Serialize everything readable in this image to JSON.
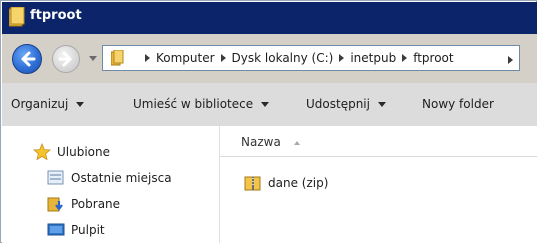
{
  "window": {
    "title": "ftproot"
  },
  "address": {
    "crumbs": [
      "Komputer",
      "Dysk lokalny (C:)",
      "inetpub",
      "ftproot"
    ]
  },
  "toolbar": {
    "organize": "Organizuj",
    "library": "Umieść w bibliotece",
    "share": "Udostępnij",
    "new_folder": "Nowy folder"
  },
  "nav": {
    "favorites": "Ulubione",
    "recent": "Ostatnie miejsca",
    "downloads": "Pobrane",
    "desktop": "Pulpit"
  },
  "content": {
    "column_name": "Nazwa",
    "items": [
      {
        "name": "dane (zip)",
        "icon": "zip-folder-icon"
      }
    ]
  },
  "colors": {
    "titlebar": "#0b246a",
    "toolbar": "#dcdcdc",
    "addressbar": "#d4d0c8"
  }
}
